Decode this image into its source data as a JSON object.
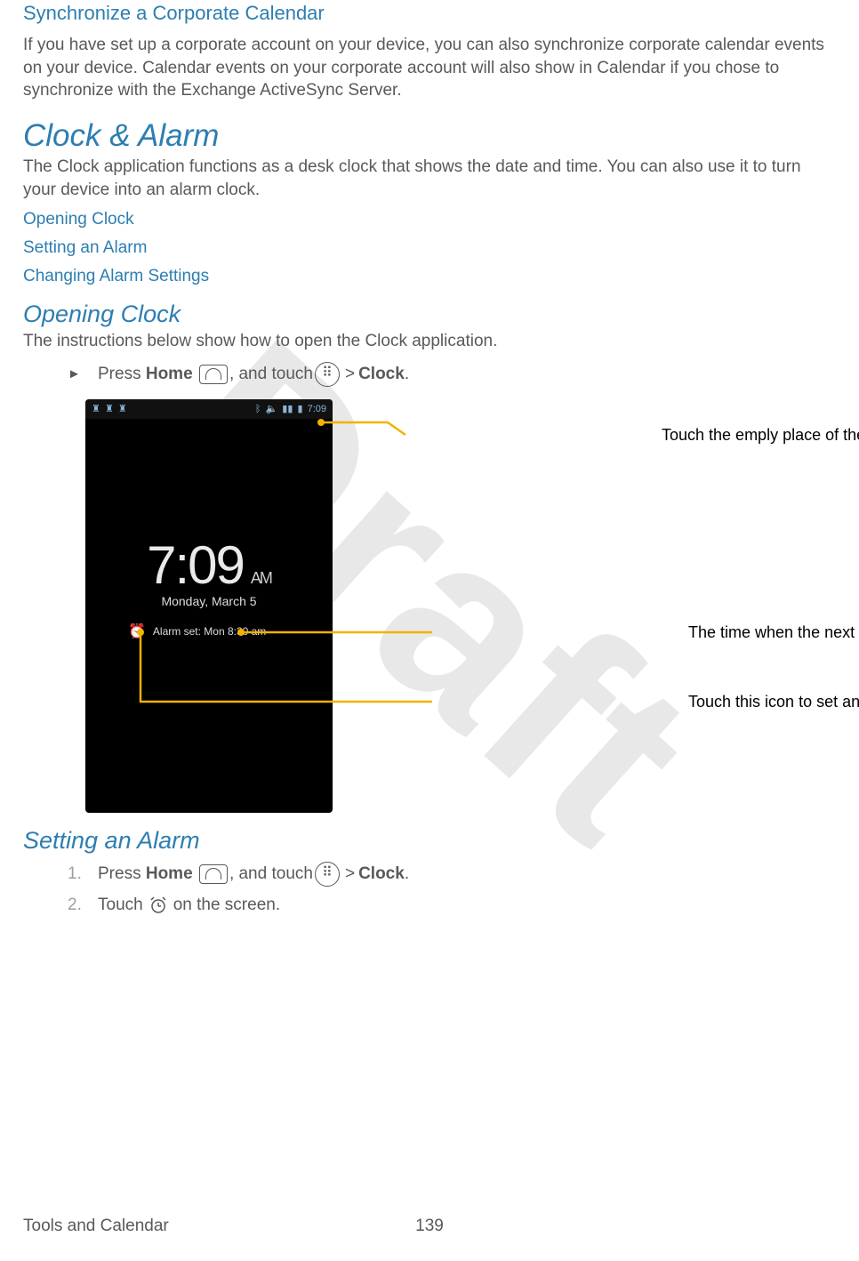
{
  "headings": {
    "sync": "Synchronize a Corporate Calendar",
    "clock_alarm": "Clock & Alarm",
    "opening_clock": "Opening Clock",
    "setting_alarm": "Setting an Alarm"
  },
  "paragraphs": {
    "sync_body": "If you have set up a corporate account on your device, you can also synchronize corporate calendar events on your device. Calendar events on your corporate account will also show in Calendar if you chose to synchronize with the Exchange ActiveSync Server.",
    "clock_alarm_body": "The Clock application functions as a desk clock that shows the date and time. You can also use it to turn your device into an alarm clock.",
    "opening_clock_body": "The instructions below show how to open the Clock application."
  },
  "links": {
    "opening_clock": "Opening Clock",
    "setting_alarm": "Setting an Alarm",
    "changing_alarm": "Changing Alarm Settings"
  },
  "steps": {
    "press": "Press ",
    "home": "Home",
    "and_touch": ", and touch ",
    "gt": " > ",
    "clock": "Clock",
    "period": ".",
    "touch": "Touch ",
    "on_screen": " on the screen.",
    "n1": "1.",
    "n2": "2.",
    "tri": "►"
  },
  "phone": {
    "status_time": "7:09",
    "time": "7:09",
    "ampm": "AM",
    "date": "Monday, March 5",
    "alarm_text": "Alarm set: Mon 8:30 am"
  },
  "callouts": {
    "c1": "Touch the emply place of the screen to dim",
    "c2": "The time when the next alarm is set.",
    "c3": "Touch this icon to set an alarm."
  },
  "footer": {
    "section": "Tools and Calendar",
    "page": "139"
  },
  "watermark": "Draft"
}
